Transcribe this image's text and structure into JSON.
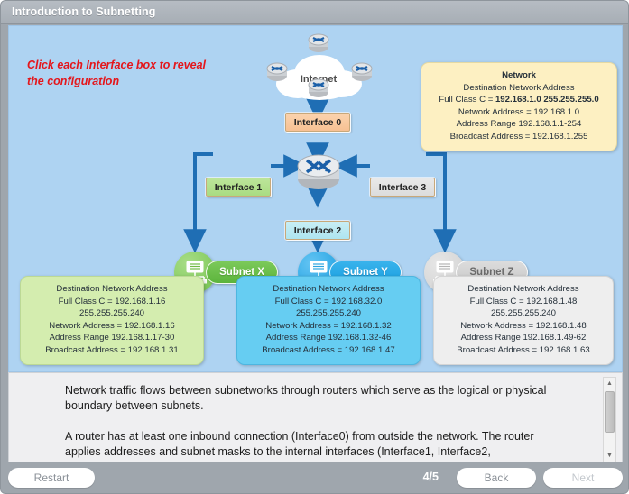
{
  "window": {
    "title": "Introduction to Subnetting"
  },
  "stage": {
    "hint": "Click each Interface box to reveal the configuration",
    "cloud_label": "Internet",
    "interfaces": [
      {
        "id": "interface-0",
        "label": "Interface 0"
      },
      {
        "id": "interface-1",
        "label": "Interface 1"
      },
      {
        "id": "interface-2",
        "label": "Interface 2"
      },
      {
        "id": "interface-3",
        "label": "Interface 3"
      }
    ],
    "subnets": [
      {
        "id": "subnet-x",
        "label": "Subnet X"
      },
      {
        "id": "subnet-y",
        "label": "Subnet Y"
      },
      {
        "id": "subnet-z",
        "label": "Subnet Z"
      }
    ]
  },
  "network_box": {
    "title": "Network",
    "l1": "Destination Network Address",
    "l2_prefix": "Full Class C = ",
    "l2_bold": "192.168.1.0 255.255.255.0",
    "l3": "Network Address = 192.168.1.0",
    "l4": "Address Range 192.168.1.1-254",
    "l5": "Broadcast Address = 192.168.1.255"
  },
  "subnet_boxes": [
    {
      "id": "subnet-x-info",
      "l1": "Destination Network Address",
      "l2": "Full Class C = 192.168.1.16",
      "l3": "255.255.255.240",
      "l4": "Network Address = 192.168.1.16",
      "l5": "Address Range 192.168.1.17-30",
      "l6": "Broadcast Address = 192.168.1.31"
    },
    {
      "id": "subnet-y-info",
      "l1": "Destination Network Address",
      "l2": "Full Class C = 192.168.32.0",
      "l3": "255.255.255.240",
      "l4": "Network Address = 192.168.1.32",
      "l5": "Address Range 192.168.1.32-46",
      "l6": "Broadcast Address = 192.168.1.47"
    },
    {
      "id": "subnet-z-info",
      "l1": "Destination Network Address",
      "l2": "Full Class C = 192.168.1.48",
      "l3": "255.255.255.240",
      "l4": "Network Address = 192.168.1.48",
      "l5": "Address Range 192.168.1.49-62",
      "l6": "Broadcast Address = 192.168.1.63"
    }
  ],
  "body": {
    "paragraph_1": "Network traffic flows between subnetworks through routers which serve as the logical or physical boundary between subnets.",
    "paragraph_2": "A router has at least one inbound connection (Interface0) from outside the network. The router applies addresses and subnet masks to the internal interfaces (Interface1, Interface2,"
  },
  "scrollbar": {
    "up_glyph": "▲",
    "down_glyph": "▼"
  },
  "nav": {
    "restart_label": "Restart",
    "page_indicator": "4/5",
    "back_label": "Back",
    "next_label": "Next"
  },
  "colors": {
    "title_bar": "#a7aeb5",
    "stage_bg": "#aed3f2",
    "hint_red": "#e4161b",
    "wire_blue": "#1f6eb4",
    "interface0": "#f7c193",
    "interface1": "#a9dc82",
    "interface2": "#aee5f0",
    "interface3": "#dcdcdc",
    "subnet_x": "#5cb43c",
    "subnet_y": "#1a9fe0",
    "subnet_z": "#c9c9c9",
    "network_box": "#fdf0c2"
  }
}
